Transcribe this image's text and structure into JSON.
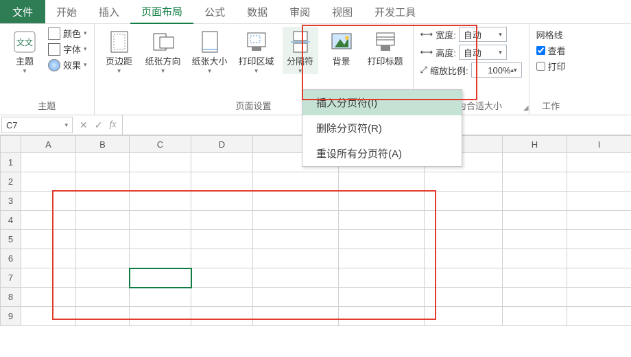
{
  "tabs": {
    "file": "文件",
    "home": "开始",
    "insert": "插入",
    "page_layout": "页面布局",
    "formulas": "公式",
    "data": "数据",
    "review": "审阅",
    "view": "视图",
    "developer": "开发工具"
  },
  "ribbon": {
    "themes": {
      "theme_label": "主题",
      "colors": "颜色",
      "fonts": "字体",
      "effects": "效果",
      "group_label": "主题"
    },
    "page_setup": {
      "margins": "页边距",
      "orientation": "纸张方向",
      "size": "纸张大小",
      "print_area": "打印区域",
      "breaks": "分隔符",
      "background": "背景",
      "print_titles": "打印标题",
      "group_label": "页面设置"
    },
    "scale_to_fit": {
      "width_label": "宽度:",
      "height_label": "高度:",
      "scale_label": "缩放比例:",
      "width_value": "自动",
      "height_value": "自动",
      "scale_value": "100%",
      "group_label": "调整为合适大小"
    },
    "sheet_options": {
      "gridlines_label": "网格线",
      "view": "查看",
      "print": "打印",
      "group_label": "工作"
    }
  },
  "breaks_menu": {
    "insert": "插入分页符(I)",
    "remove": "删除分页符(R)",
    "reset": "重设所有分页符(A)"
  },
  "formula_bar": {
    "namebox": "C7",
    "fx": "fx"
  },
  "grid": {
    "cols": [
      "A",
      "B",
      "C",
      "D",
      "",
      "",
      "",
      "H",
      "I"
    ],
    "rows": [
      "1",
      "2",
      "3",
      "4",
      "5",
      "6",
      "7",
      "8",
      "9"
    ],
    "selected_col_index": 2,
    "selected_row_index": 6
  }
}
